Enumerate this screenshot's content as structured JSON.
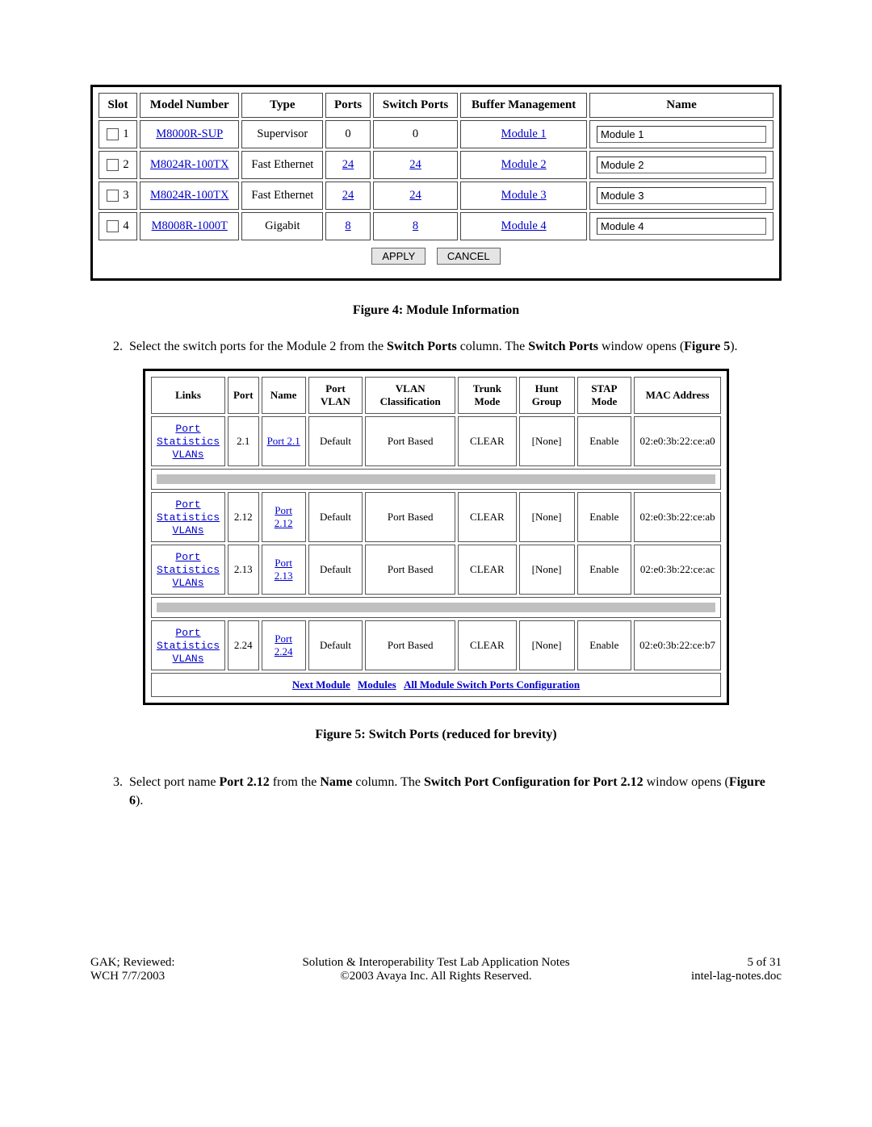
{
  "module_table": {
    "headers": [
      "Slot",
      "Model Number",
      "Type",
      "Ports",
      "Switch Ports",
      "Buffer Management",
      "Name"
    ],
    "rows": [
      {
        "slot": "1",
        "model": "M8000R-SUP",
        "type": "Supervisor",
        "ports": "0",
        "ports_link": false,
        "swports": "0",
        "swports_link": false,
        "buf": "Module 1",
        "name": "Module 1"
      },
      {
        "slot": "2",
        "model": "M8024R-100TX",
        "type": "Fast Ethernet",
        "ports": "24",
        "ports_link": true,
        "swports": "24",
        "swports_link": true,
        "buf": "Module 2",
        "name": "Module 2"
      },
      {
        "slot": "3",
        "model": "M8024R-100TX",
        "type": "Fast Ethernet",
        "ports": "24",
        "ports_link": true,
        "swports": "24",
        "swports_link": true,
        "buf": "Module 3",
        "name": "Module 3"
      },
      {
        "slot": "4",
        "model": "M8008R-1000T",
        "type": "Gigabit",
        "ports": "8",
        "ports_link": true,
        "swports": "8",
        "swports_link": true,
        "buf": "Module 4",
        "name": "Module 4"
      }
    ],
    "apply": "APPLY",
    "cancel": "CANCEL"
  },
  "fig4": "Figure 4: Module Information",
  "step2": {
    "num": "2.",
    "t1": "Select the switch ports for the Module 2 from the ",
    "b1": "Switch Ports",
    "t2": " column.  The ",
    "b2": "Switch Ports",
    "t3": " window opens (",
    "b3": "Figure 5",
    "t4": ")."
  },
  "switch_table": {
    "headers": [
      "Links",
      "Port",
      "Name",
      "Port VLAN",
      "VLAN Classification",
      "Trunk Mode",
      "Hunt Group",
      "STAP Mode",
      "MAC Address"
    ],
    "link_labels": [
      "Port",
      "Statistics",
      "VLANs"
    ],
    "rows": [
      {
        "port": "2.1",
        "name": "Port 2.1",
        "pvlan": "Default",
        "vclass": "Port Based",
        "trunk": "CLEAR",
        "hunt": "[None]",
        "stap": "Enable",
        "mac": "02:e0:3b:22:ce:a0"
      },
      {
        "port": "2.12",
        "name": "Port 2.12",
        "pvlan": "Default",
        "vclass": "Port Based",
        "trunk": "CLEAR",
        "hunt": "[None]",
        "stap": "Enable",
        "mac": "02:e0:3b:22:ce:ab"
      },
      {
        "port": "2.13",
        "name": "Port 2.13",
        "pvlan": "Default",
        "vclass": "Port Based",
        "trunk": "CLEAR",
        "hunt": "[None]",
        "stap": "Enable",
        "mac": "02:e0:3b:22:ce:ac"
      },
      {
        "port": "2.24",
        "name": "Port 2.24",
        "pvlan": "Default",
        "vclass": "Port Based",
        "trunk": "CLEAR",
        "hunt": "[None]",
        "stap": "Enable",
        "mac": "02:e0:3b:22:ce:b7"
      }
    ],
    "footer_links": [
      "Next Module",
      "Modules",
      "All Module Switch Ports Configuration"
    ]
  },
  "fig5": "Figure 5: Switch Ports (reduced for brevity)",
  "step3": {
    "num": "3.",
    "t1": "Select port name ",
    "b1": "Port 2.12",
    "t2": " from the ",
    "b2": "Name",
    "t3": " column.  The ",
    "b3": "Switch Port Configuration for Port 2.12",
    "t4": " window opens (",
    "b4": "Figure 6",
    "t5": ")."
  },
  "footer": {
    "left1": "GAK; Reviewed:",
    "left2": "WCH 7/7/2003",
    "center1": "Solution & Interoperability Test Lab Application Notes",
    "center2": "©2003 Avaya Inc. All Rights Reserved.",
    "right1": "5 of 31",
    "right2": "intel-lag-notes.doc"
  }
}
